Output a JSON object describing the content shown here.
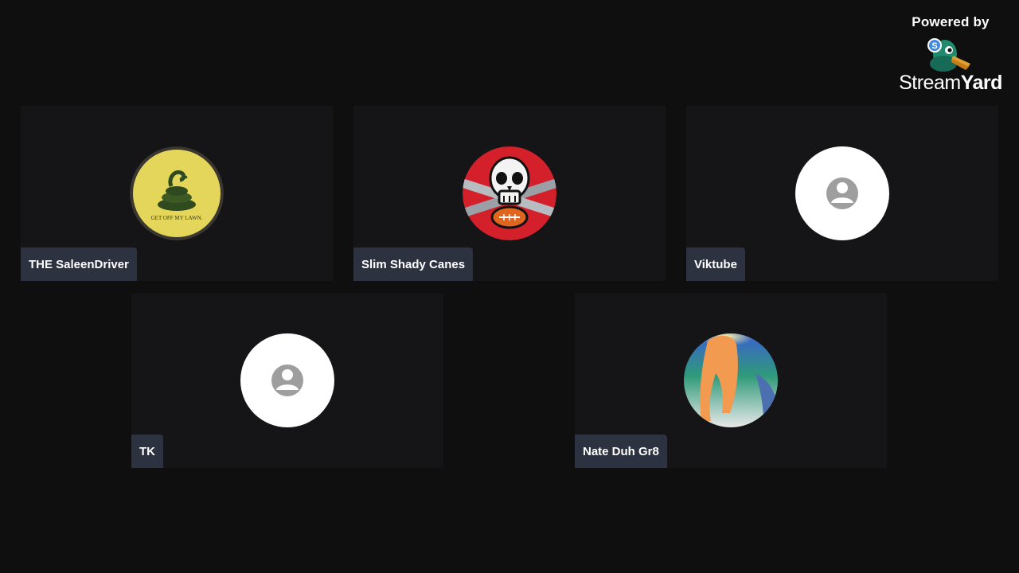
{
  "branding": {
    "powered_label": "Powered by",
    "name_part1": "Stream",
    "name_part2": "Yard",
    "icon": "streamyard-duck-logo"
  },
  "participants": [
    {
      "name": "THE SaleenDriver",
      "avatar": "gadsden-flag-avatar",
      "avatar_caption": "GET OFF MY LAWN."
    },
    {
      "name": "Slim Shady Canes",
      "avatar": "pirate-skull-football-avatar"
    },
    {
      "name": "Viktube",
      "avatar": "default-user-icon"
    },
    {
      "name": "TK",
      "avatar": "default-user-icon"
    },
    {
      "name": "Nate Duh Gr8",
      "avatar": "photo-avatar"
    }
  ],
  "colors": {
    "background": "#0f0f10",
    "tile": "#151517",
    "nameplate": "#2d3240"
  }
}
